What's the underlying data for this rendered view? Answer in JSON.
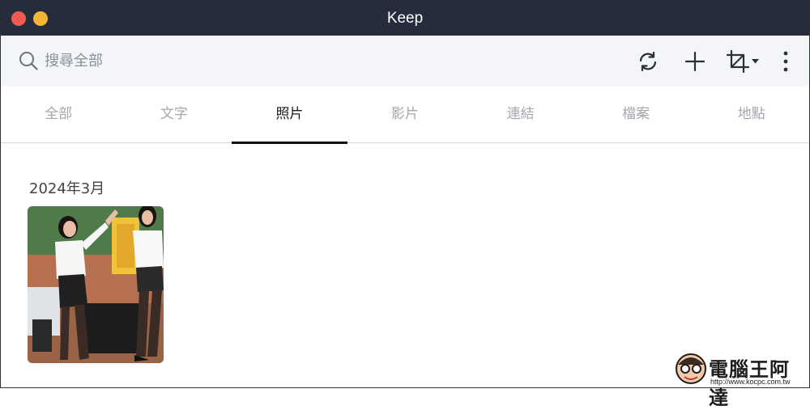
{
  "window": {
    "title": "Keep"
  },
  "toolbar": {
    "search_placeholder": "搜尋全部",
    "icons": [
      "search-icon",
      "refresh-icon",
      "add-icon",
      "crop-icon",
      "chevron-down-icon",
      "more-vertical-icon"
    ]
  },
  "tabs": [
    {
      "label": "全部",
      "active": false
    },
    {
      "label": "文字",
      "active": false
    },
    {
      "label": "照片",
      "active": true
    },
    {
      "label": "影片",
      "active": false
    },
    {
      "label": "連結",
      "active": false
    },
    {
      "label": "檔案",
      "active": false
    },
    {
      "label": "地點",
      "active": false
    }
  ],
  "content": {
    "section_date": "2024年3月"
  },
  "watermark": {
    "text": "電腦王阿達",
    "url": "http://www.kocpc.com.tw"
  },
  "colors": {
    "titlebar": "#252d3d",
    "toolbar": "#f4f5f8",
    "close": "#f05a52",
    "minimize": "#f3b634",
    "active_tab_underline": "#111111",
    "inactive_tab_text": "#a4a7ad"
  }
}
